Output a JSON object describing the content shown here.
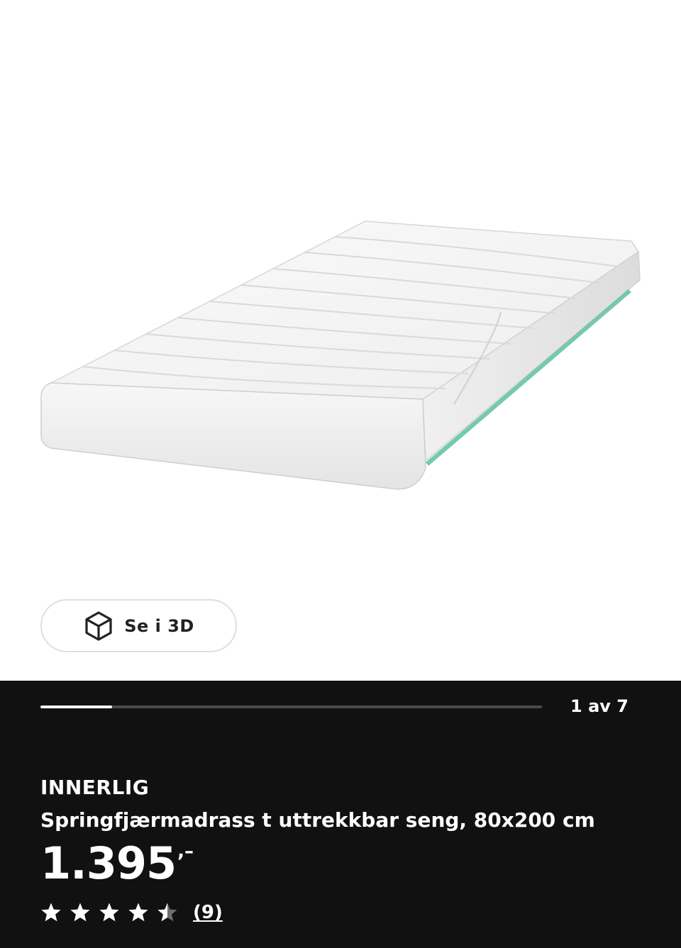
{
  "gallery": {
    "view_3d_label": "Se i 3D",
    "counter": "1 av 7",
    "current_image": 1,
    "total_images": 7
  },
  "product": {
    "name": "INNERLIG",
    "description": "Springfjærmadrass t uttrekkbar seng, 80x200 cm",
    "price": "1.395",
    "price_suffix": ",–",
    "rating": 4.5,
    "rating_max": 5,
    "review_count": "(9)"
  },
  "colors": {
    "panel_background": "#111111",
    "accent_strip": "#3bb38a"
  },
  "icons": {
    "view_3d": "cube-icon",
    "rating_star": "star-icon"
  }
}
